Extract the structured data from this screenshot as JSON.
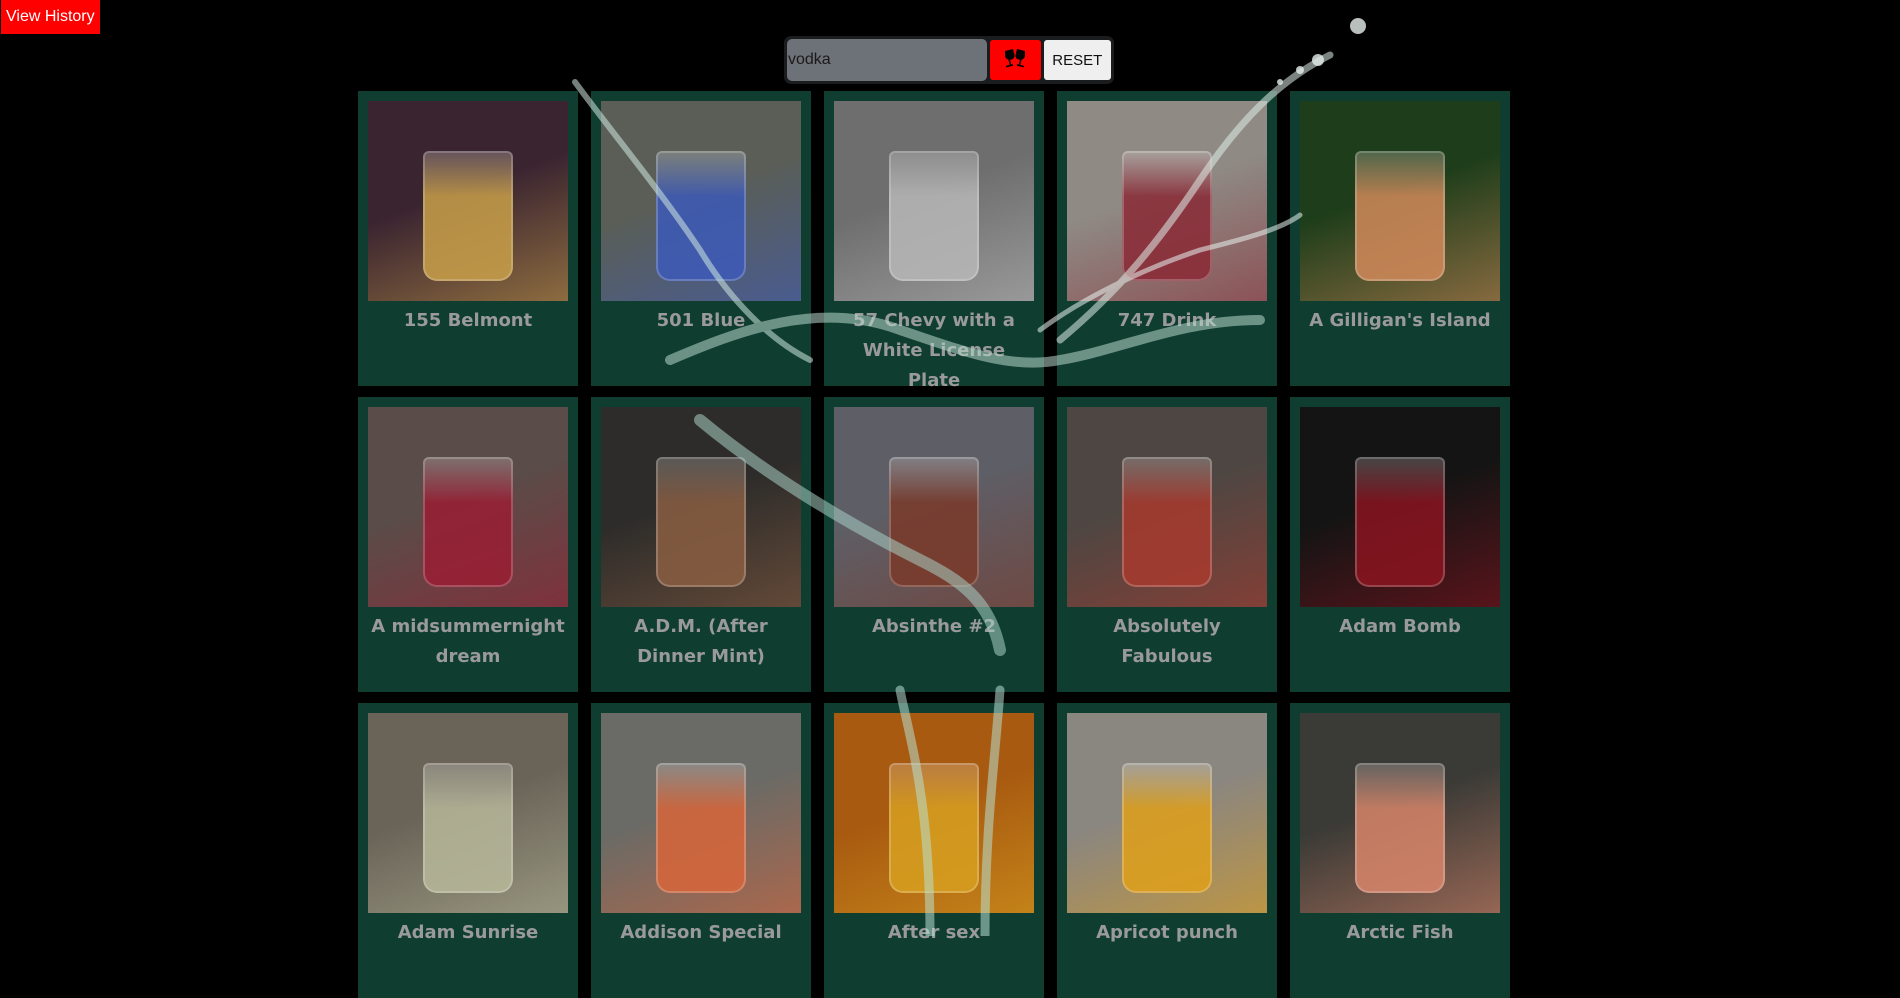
{
  "header": {
    "history_label": "View History"
  },
  "search": {
    "value": "vodka",
    "placeholder": "",
    "search_icon": "wine-glasses-cheers-icon",
    "reset_label": "RESET"
  },
  "colors": {
    "accent_red": "#ff0000",
    "card_green": "#0f3d30",
    "background": "#000000",
    "title_gray": "#9a9a9a"
  },
  "drinks": [
    {
      "name": "155 Belmont",
      "tone": [
        "#3a2430",
        "#c9a04a"
      ]
    },
    {
      "name": "501 Blue",
      "tone": [
        "#5a5e56",
        "#3d5ab8"
      ]
    },
    {
      "name": "57 Chevy with a White License Plate",
      "tone": [
        "#6e6e6e",
        "#b8b8b8"
      ]
    },
    {
      "name": "747 Drink",
      "tone": [
        "#8f8a84",
        "#8a2a36"
      ]
    },
    {
      "name": "A Gilligan's Island",
      "tone": [
        "#1e3d1a",
        "#d28a5a"
      ]
    },
    {
      "name": "A midsummernight dream",
      "tone": [
        "#5a4c48",
        "#9a1e34"
      ]
    },
    {
      "name": "A.D.M. (After Dinner Mint)",
      "tone": [
        "#2d2c2a",
        "#8a5e42"
      ]
    },
    {
      "name": "Absinthe #2",
      "tone": [
        "#5e5e66",
        "#7a3a2a"
      ]
    },
    {
      "name": "Absolutely Fabulous",
      "tone": [
        "#4e4642",
        "#a83a2e"
      ]
    },
    {
      "name": "Adam Bomb",
      "tone": [
        "#141414",
        "#8a1420"
      ]
    },
    {
      "name": "Adam Sunrise",
      "tone": [
        "#6a6458",
        "#b8b89a"
      ]
    },
    {
      "name": "Addison Special",
      "tone": [
        "#6a6a66",
        "#d8663a"
      ]
    },
    {
      "name": "After sex",
      "tone": [
        "#a85a10",
        "#d8a020"
      ]
    },
    {
      "name": "Apricot punch",
      "tone": [
        "#8a8680",
        "#e0a01a"
      ]
    },
    {
      "name": "Arctic Fish",
      "tone": [
        "#3a3a36",
        "#d8866a"
      ]
    }
  ]
}
